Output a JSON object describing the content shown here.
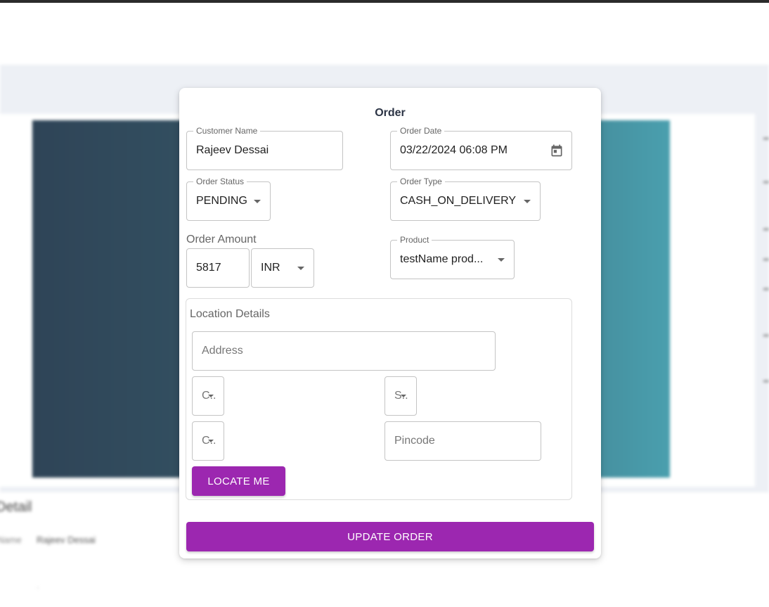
{
  "background": {
    "title": "Detail",
    "name_label": "Name",
    "name_value": "Rajeev Dessai",
    "dot": "·"
  },
  "dialog": {
    "title": "Order",
    "customer_name": {
      "label": "Customer Name",
      "value": "Rajeev Dessai"
    },
    "order_date": {
      "label": "Order Date",
      "value": "03/22/2024 06:08 PM",
      "icon": "calendar-icon"
    },
    "order_status": {
      "label": "Order Status",
      "value": "PENDING"
    },
    "order_type": {
      "label": "Order Type",
      "value": "CASH_ON_DELIVERY"
    },
    "order_amount": {
      "label": "Order Amount",
      "value": "5817",
      "currency": "INR"
    },
    "product": {
      "label": "Product",
      "value": "testName prod..."
    },
    "location": {
      "title": "Location Details",
      "address_placeholder": "Address",
      "city_placeholder": "C..",
      "state_placeholder": "S..",
      "country_placeholder": "C..",
      "pincode_placeholder": "Pincode",
      "locate_button": "LOCATE ME"
    },
    "update_button": "UPDATE ORDER"
  },
  "colors": {
    "accent": "#9c27b0",
    "title": "#2c3445",
    "background_band": "#edf0f5"
  }
}
